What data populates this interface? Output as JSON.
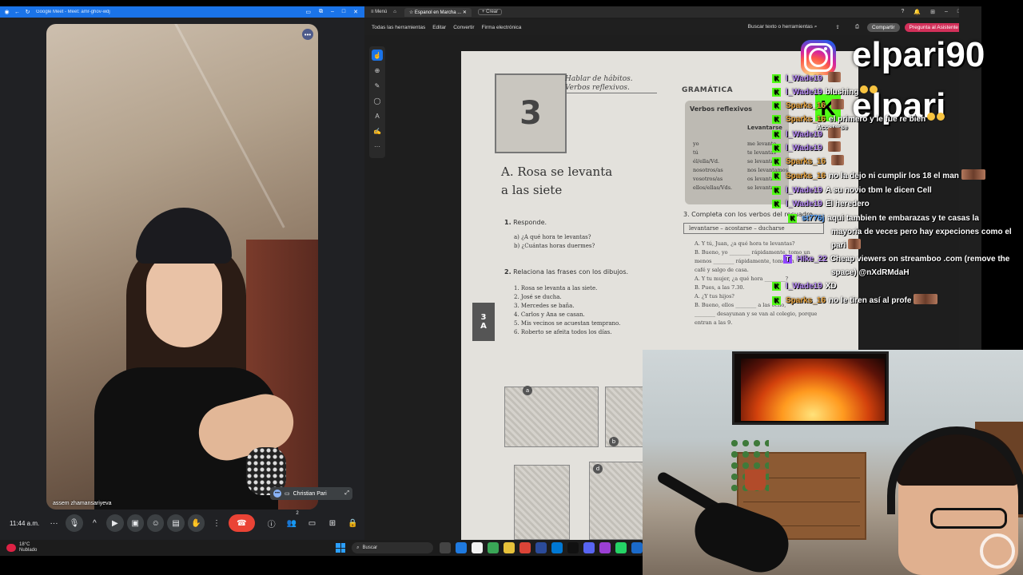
{
  "meet": {
    "window_title": "Google Meet - Meet: amr-ghov-wdj",
    "participant_name": "assem zhamansariyeva",
    "self_name": "Christian Pari",
    "time": "11:44 a.m.",
    "participants_count": "2"
  },
  "pdf": {
    "menu_label": "Menú",
    "tab_title": "Espanol en Marcha ...",
    "new_tab_label": "Crear",
    "toolbar": {
      "all_tools": "Todas las herramientas",
      "edit": "Editar",
      "convert": "Convertir",
      "sign": "Firma electrónica",
      "search": "Buscar texto o herramientas",
      "share": "Compartir",
      "ai": "Pregunta al Asistente de IA"
    },
    "page": {
      "unit_number": "3",
      "unit_subtitle_1": "Hablar de hábitos.",
      "unit_subtitle_2": "Verbos reflexivos.",
      "lesson_title_1": "A. Rosa se levanta",
      "lesson_title_2": "a las siete",
      "side_tab_1": "3",
      "side_tab_2": "A",
      "ex1_title": "Responde.",
      "ex1_q1": "a) ¿A qué hora te levantas?",
      "ex1_q2": "b) ¿Cuántas horas duermes?",
      "ex2_title": "Relaciona las frases con los dibujos.",
      "ex2_items": [
        "1. Rosa se levanta a las siete.",
        "2. José se ducha.",
        "3. Mercedes se baña.",
        "4. Carlos y Ana se casan.",
        "5. Mis vecinos se acuestan temprano.",
        "6. Roberto se afeita todos los días."
      ],
      "grammar_heading": "GRAMÁTICA",
      "verbs_title": "Verbos reflexivos",
      "verbs_col": "Levantarse",
      "pronouns": [
        "yo",
        "tú",
        "él/ella/Vd.",
        "nosotros/as",
        "vosotros/as",
        "ellos/ellas/Vds."
      ],
      "verb_forms": [
        "me levanto",
        "te levantas",
        "se levanta",
        "nos levantamos",
        "os levantáis",
        "se levantan"
      ],
      "ex3_title": "3. Completa con los verbos del recuadro.",
      "ex3_box": "levantarse – acostarse – ducharse",
      "ex3_lines": [
        "A. Y tú, Juan, ¿a qué hora te levantas?",
        "B. Bueno, yo ________ rápidamente, tomo un",
        "menos ________ rápidamente, tomo un",
        "café y salgo de casa.",
        "A. Y tu mujer, ¿a qué hora ________?",
        "B. Pues, a las 7.30.",
        "A. ¿Y tus hijos?",
        "B. Bueno, ellos ________ a las ocho,",
        "________ desayunan y se van al colegio, porque",
        "entran a las 9."
      ],
      "drawing_labels": [
        "a",
        "b",
        "d"
      ]
    }
  },
  "overlay": {
    "ig_handle": "elpari90",
    "kick_handle": "elpari",
    "chat": [
      {
        "platform": "kick",
        "user": "l_Wade19",
        "msg": "",
        "emote": true
      },
      {
        "platform": "kick",
        "user": "l_Wade19",
        "msg": "blushing",
        "emote": false
      },
      {
        "platform": "kick",
        "user": "Sparks_16",
        "msg": "",
        "emote": true
      },
      {
        "platform": "kick",
        "user": "Sparks_16",
        "msg": "el primero y le fue re bien",
        "emote": false
      },
      {
        "platform": "kick",
        "user": "l_Wade19",
        "msg": "",
        "emote": true
      },
      {
        "platform": "kick",
        "user": "l_Wade19",
        "msg": "",
        "emote": true
      },
      {
        "platform": "kick",
        "user": "Sparks_16",
        "msg": "",
        "emote": true
      },
      {
        "platform": "kick",
        "user": "Sparks_16",
        "msg": "no la dejo ni cumplir los 18 el man",
        "emote": true
      },
      {
        "platform": "kick",
        "user": "l_Wade19",
        "msg": "A su novio tbm le dicen Cell",
        "emote": false
      },
      {
        "platform": "kick",
        "user": "l_Wade19",
        "msg": "El heredero",
        "emote": false
      },
      {
        "platform": "kick",
        "user": "st776j",
        "msg": "aqui tambien te embarazas y te casas la",
        "emote": false
      },
      {
        "platform": "kick",
        "user": "",
        "msg": "mayoria de veces pero hay expeciones como el",
        "emote": false
      },
      {
        "platform": "kick",
        "user": "",
        "msg": "pari",
        "emote": true
      },
      {
        "platform": "twitch",
        "user": "Hike_22",
        "msg": "Cheap viewers on streamboo .com (remove the",
        "emote": false
      },
      {
        "platform": "twitch",
        "user": "",
        "msg": "space) @nXdRMdaH",
        "emote": false
      },
      {
        "platform": "kick",
        "user": "l_Wade19",
        "msg": "XD",
        "emote": false
      },
      {
        "platform": "kick",
        "user": "Sparks_16",
        "msg": "no le tiren así al profe",
        "emote": true
      }
    ],
    "verbs_overlay_text": "Acostarse"
  },
  "taskbar": {
    "temperature": "18°C",
    "condition": "Nublado",
    "search_label": "Buscar"
  },
  "colors": {
    "meet_blue": "#1a73e8",
    "end_call_red": "#ea4335",
    "kick_green": "#53fc18",
    "twitch_purple": "#9146ff",
    "ai_button": "#d3305a"
  }
}
